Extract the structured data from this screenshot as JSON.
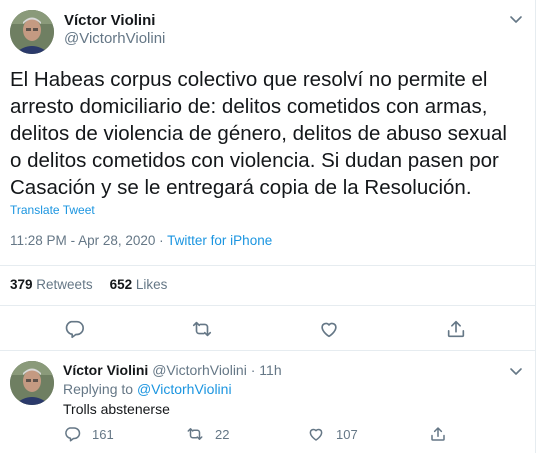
{
  "main_tweet": {
    "author_name": "Víctor Violini",
    "author_handle": "@VictorhViolini",
    "text": "El Habeas corpus colectivo que resolví no permite el\narresto domiciliario de: delitos cometidos con armas,\ndelitos de violencia de género, delitos de abuso sexual\no delitos cometidos con violencia. Si dudan pasen por\nCasación y se le entregará copia de la Resolución.",
    "translate_label": "Translate Tweet",
    "time": "11:28 PM",
    "date": "Apr 28, 2020",
    "separator": "·",
    "source": "Twitter for iPhone",
    "retweets_count": "379",
    "retweets_label": "Retweets",
    "likes_count": "652",
    "likes_label": "Likes",
    "actions": {
      "reply_icon": "reply-icon",
      "retweet_icon": "retweet-icon",
      "like_icon": "heart-icon",
      "share_icon": "share-icon"
    }
  },
  "reply_tweet": {
    "author_name": "Víctor Violini",
    "author_handle": "@VictorhViolini",
    "separator": "·",
    "time_ago": "11h",
    "replying_to_label": "Replying to",
    "replying_to_handle": "@VictorhViolini",
    "text": "Trolls abstenerse",
    "reply_count": "161",
    "retweet_count": "22",
    "like_count": "107"
  },
  "colors": {
    "link": "#1b95e0",
    "secondary_text": "#657786",
    "primary_text": "#14171a",
    "divider": "#e6ecf0"
  }
}
